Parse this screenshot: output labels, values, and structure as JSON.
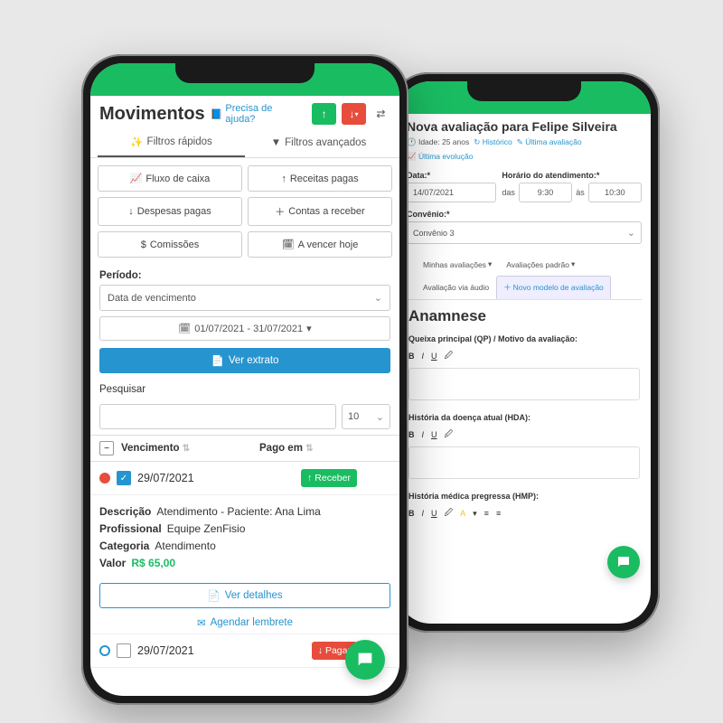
{
  "phone1": {
    "title": "Movimentos",
    "help": "Precisa de ajuda?",
    "tabs": {
      "quick": "Filtros rápidos",
      "advanced": "Filtros avançados"
    },
    "chips": {
      "c1": "Fluxo de caixa",
      "c2": "Receitas pagas",
      "c3": "Despesas pagas",
      "c4": "Contas a receber",
      "c5": "Comissões",
      "c6": "A vencer hoje"
    },
    "period": {
      "label": "Período:",
      "select": "Data de vencimento",
      "range": "01/07/2021 - 31/07/2021"
    },
    "extract_btn": "Ver extrato",
    "search_label": "Pesquisar",
    "page_size": "10",
    "thead": {
      "col1": "Vencimento",
      "col2": "Pago em"
    },
    "row1": {
      "date": "29/07/2021",
      "action": "Receber"
    },
    "detail": {
      "desc_k": "Descrição",
      "desc_v": "Atendimento - Paciente: Ana Lima",
      "prof_k": "Profissional",
      "prof_v": "Equipe ZenFisio",
      "cat_k": "Categoria",
      "cat_v": "Atendimento",
      "val_k": "Valor",
      "val_v": "R$ 65,00",
      "details_btn": "Ver detalhes",
      "reminder_btn": "Agendar lembrete"
    },
    "row2": {
      "date": "29/07/2021",
      "action": "Pagar"
    }
  },
  "phone2": {
    "title": "Nova avaliação para Felipe Silveira",
    "meta": {
      "age_lbl": "Idade:",
      "age": "25 anos",
      "hist": "Histórico",
      "last_eval": "Última avaliação",
      "last_evo": "Última evolução"
    },
    "date_lbl": "Data:*",
    "date_val": "14/07/2021",
    "time_lbl": "Horário do atendimento:*",
    "das": "das",
    "t1": "9:30",
    "as": "às",
    "t2": "10:30",
    "conv_lbl": "Convênio:*",
    "conv_val": "Convênio 3",
    "eval_tabs": {
      "t1": "Minhas avaliações",
      "t2": "Avaliações padrão",
      "t3": "Avaliação via áudio",
      "t4": "Novo modelo de avaliação"
    },
    "anamnese": "Anamnese",
    "f1": "Queixa principal (QP) / Motivo da avaliação:",
    "f2": "História da doença atual (HDA):",
    "f3": "História médica pregressa (HMP):",
    "rt": {
      "b": "B",
      "i": "I",
      "u": "U"
    }
  }
}
